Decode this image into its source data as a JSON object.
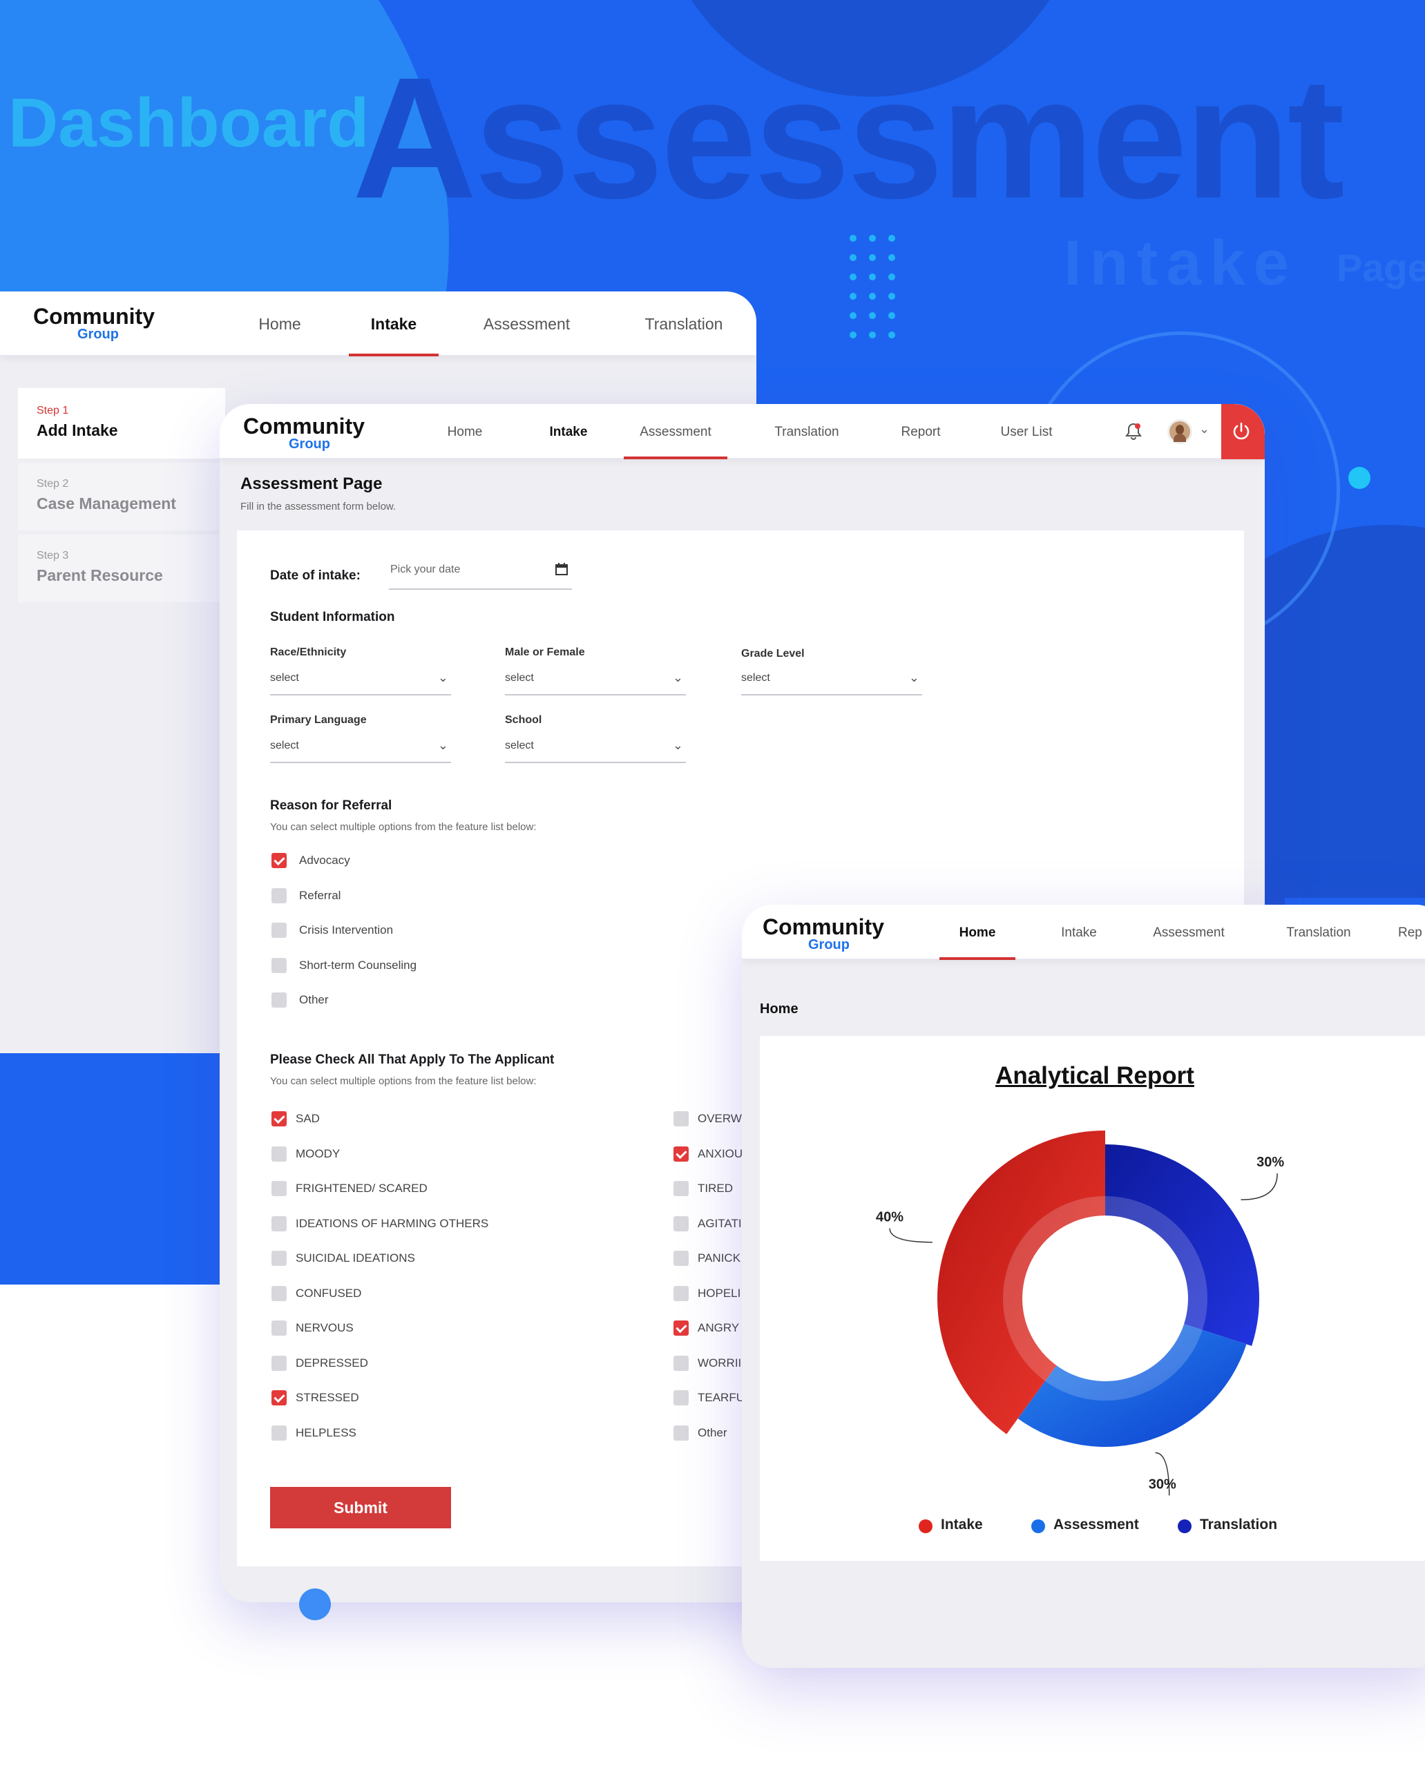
{
  "hero": {
    "word_dashboard": "Dashboard",
    "word_assessment": "Assessment",
    "word_intake": "Intake",
    "word_page": "Page"
  },
  "colors": {
    "brand_blue": "#1d63f0",
    "accent_red": "#d33333",
    "intake_red": "#e0251f",
    "assessment_blue": "#1a6fe8",
    "translation_navy": "#1422b8"
  },
  "logo": {
    "name": "Community",
    "sub": "Group"
  },
  "window_back": {
    "nav": [
      "Home",
      "Intake",
      "Assessment",
      "Translation"
    ],
    "active": "Intake",
    "steps": [
      {
        "step": "Step 1",
        "title": "Add Intake"
      },
      {
        "step": "Step 2",
        "title": "Case Management"
      },
      {
        "step": "Step 3",
        "title": "Parent Resource"
      }
    ]
  },
  "window_main": {
    "nav": [
      "Home",
      "Intake",
      "Assessment",
      "Translation",
      "Report",
      "User List"
    ],
    "active": "Assessment",
    "page_title": "Assessment Page",
    "page_subtitle": "Fill in the assessment form below.",
    "date_label": "Date of intake:",
    "date_placeholder": "Pick your date",
    "student_info": "Student Information",
    "fields": [
      {
        "label": "Race/Ethnicity",
        "value": "select"
      },
      {
        "label": "Male or Female",
        "value": "select"
      },
      {
        "label": "Grade Level",
        "value": "select"
      },
      {
        "label": "Primary Language",
        "value": "select"
      },
      {
        "label": "School",
        "value": "select"
      }
    ],
    "referral_title": "Reason for Referral",
    "referral_hint": "You can select multiple options from the feature list below:",
    "referral_options": [
      {
        "label": "Advocacy",
        "checked": true
      },
      {
        "label": "Referral",
        "checked": false
      },
      {
        "label": "Crisis Intervention",
        "checked": false
      },
      {
        "label": "Short-term Counseling",
        "checked": false
      },
      {
        "label": "Other",
        "checked": false
      }
    ],
    "applicant_title": "Please Check All That Apply To The Applicant",
    "applicant_hint": "You can select multiple options from the feature list below:",
    "applicant_left": [
      {
        "label": "SAD",
        "checked": true
      },
      {
        "label": "MOODY",
        "checked": false
      },
      {
        "label": "FRIGHTENED/ SCARED",
        "checked": false
      },
      {
        "label": "IDEATIONS OF HARMING OTHERS",
        "checked": false
      },
      {
        "label": "SUICIDAL IDEATIONS",
        "checked": false
      },
      {
        "label": "CONFUSED",
        "checked": false
      },
      {
        "label": "NERVOUS",
        "checked": false
      },
      {
        "label": "DEPRESSED",
        "checked": false
      },
      {
        "label": "STRESSED",
        "checked": true
      },
      {
        "label": "HELPLESS",
        "checked": false
      }
    ],
    "applicant_right": [
      {
        "label": "OVERW",
        "checked": false
      },
      {
        "label": "ANXIOU",
        "checked": true
      },
      {
        "label": "TIRED",
        "checked": false
      },
      {
        "label": "AGITATI",
        "checked": false
      },
      {
        "label": "PANICK",
        "checked": false
      },
      {
        "label": "HOPELI",
        "checked": false
      },
      {
        "label": "ANGRY",
        "checked": true
      },
      {
        "label": "WORRII",
        "checked": false
      },
      {
        "label": "TEARFU",
        "checked": false
      },
      {
        "label": "Other",
        "checked": false
      }
    ],
    "submit": "Submit"
  },
  "window_report": {
    "nav": [
      "Home",
      "Intake",
      "Assessment",
      "Translation",
      "Rep"
    ],
    "active": "Home",
    "breadcrumb": "Home",
    "title": "Analytical Report",
    "legend": [
      "Intake",
      "Assessment",
      "Translation"
    ]
  },
  "chart_data": {
    "type": "pie",
    "title": "Analytical Report",
    "categories": [
      "Intake",
      "Assessment",
      "Translation"
    ],
    "values": [
      40,
      30,
      30
    ],
    "labels": [
      "40%",
      "30%",
      "30%"
    ],
    "colors": [
      "#e0251f",
      "#1a6fe8",
      "#1422b8"
    ],
    "donut": true,
    "legend": "bottom"
  }
}
